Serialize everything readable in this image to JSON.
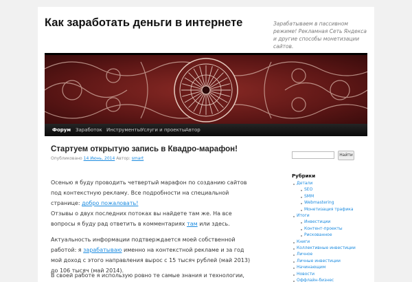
{
  "header": {
    "title": "Как заработать деньги в интернете",
    "description": "Зарабатываем в пассивном режиме! Рекламная Сеть Яндекса и другие способы монетизации сайтов."
  },
  "nav": [
    "Форум",
    "Заработок",
    "Инструменты",
    "Услуги и проекты",
    "Автор"
  ],
  "post": {
    "title": "Стартуем открытую запись в Квадро-марафон!",
    "meta_published": "Опубликовано",
    "meta_date": "14 Июнь, 2014",
    "meta_author_label": "Автор:",
    "meta_author": "smart",
    "p1_text": "Осенью я буду проводить четвертый марафон по созданию сайтов под контекстную рекламу. Все подробности на специальной странице: ",
    "p1_link": "добро пожаловать!",
    "p2_text_a": "Отзывы о двух последних потоках вы найдете там же. На все вопросы я буду рад ответить в комментариях ",
    "p2_link": "там",
    "p2_text_b": " или здесь.",
    "p3_text_a": "Актуальность информации подтверждается моей собственной работой: я ",
    "p3_link": "зарабатываю",
    "p3_text_b": " именно на контекстной рекламе и за год мой доход с этого направления вырос с 15 тысяч рублей (май 2013) до 106 тысяч (май 2014).",
    "p4_text": "В своей работе я использую ровно те самые знания и технологии, которые даю в своем марафоне."
  },
  "sidebar": {
    "search_placeholder": "",
    "search_button": "Найти",
    "categories_title": "Рубрики",
    "categories": [
      {
        "label": "Детали",
        "level": 0
      },
      {
        "label": "SEO",
        "level": 1
      },
      {
        "label": "SMM",
        "level": 1
      },
      {
        "label": "Webmastering",
        "level": 1
      },
      {
        "label": "Монетизация трафика",
        "level": 1
      },
      {
        "label": "Итоги",
        "level": 0
      },
      {
        "label": "Инвестиции",
        "level": 1
      },
      {
        "label": "Контент-проекты",
        "level": 1
      },
      {
        "label": "Рискованное",
        "level": 1
      },
      {
        "label": "Книги",
        "level": 0
      },
      {
        "label": "Коллективные инвестиции",
        "level": 0
      },
      {
        "label": "Личное",
        "level": 0
      },
      {
        "label": "Личные инвестиции",
        "level": 0
      },
      {
        "label": "Начинающим",
        "level": 0
      },
      {
        "label": "Новости",
        "level": 0
      },
      {
        "label": "Оффлайн-бизнес",
        "level": 0
      }
    ]
  },
  "colors": {
    "link": "#1b8be0",
    "nav_bg": "#111111",
    "banner": "#6e1a1a"
  }
}
